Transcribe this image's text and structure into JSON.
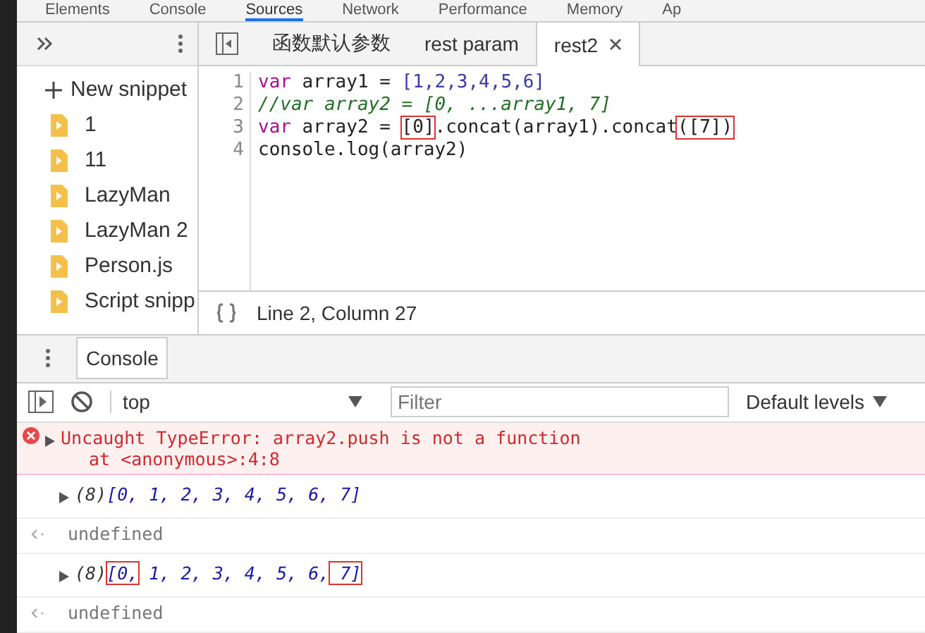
{
  "main_tabs": [
    {
      "label": "Elements",
      "selected": false
    },
    {
      "label": "Console",
      "selected": false
    },
    {
      "label": "Sources",
      "selected": true
    },
    {
      "label": "Network",
      "selected": false
    },
    {
      "label": "Performance",
      "selected": false
    },
    {
      "label": "Memory",
      "selected": false
    },
    {
      "label": "Ap",
      "selected": false
    }
  ],
  "sidebar": {
    "new_snippet": "New snippet",
    "items": [
      "1",
      "11",
      "LazyMan",
      "LazyMan 2",
      "Person.js",
      "Script snipp"
    ]
  },
  "editor_tabs": [
    {
      "label": "函数默认参数",
      "selected": false,
      "closable": false
    },
    {
      "label": "rest param",
      "selected": false,
      "closable": false
    },
    {
      "label": "rest2",
      "selected": true,
      "closable": true
    }
  ],
  "code_lines": [
    {
      "number": "1",
      "tokens": [
        {
          "kind": "keyword",
          "text": "var"
        },
        {
          "kind": "plain",
          "text": " array1 = "
        },
        {
          "kind": "number",
          "text": "[1,2,3,4,5,6]"
        }
      ]
    },
    {
      "number": "2",
      "tokens": [
        {
          "kind": "comment",
          "text": "//var array2 = [0, ...array1, 7]"
        }
      ]
    },
    {
      "number": "3",
      "tokens": [
        {
          "kind": "keyword",
          "text": "var"
        },
        {
          "kind": "plain",
          "text": " array2 = "
        },
        {
          "kind": "plain",
          "text": "[0]",
          "boxed": true
        },
        {
          "kind": "plain",
          "text": ".concat(array1).concat"
        },
        {
          "kind": "plain",
          "text": "([7])",
          "boxed": true
        }
      ]
    },
    {
      "number": "4",
      "tokens": [
        {
          "kind": "plain",
          "text": "console.log(array2)"
        }
      ]
    }
  ],
  "status": "Line 2, Column 27",
  "drawer_tab": "Console",
  "console_toolbar": {
    "context": "top",
    "filter_placeholder": "Filter",
    "levels": "Default levels"
  },
  "messages": [
    {
      "kind": "error",
      "lines": [
        "Uncaught TypeError: array2.push is not a function",
        "at <anonymous>:4:8"
      ]
    },
    {
      "kind": "array",
      "count": "(8)",
      "parts": [
        {
          "text": "[0,",
          "boxed": false
        },
        {
          "text": " 1, 2, 3, 4, 5, 6,",
          "boxed": false
        },
        {
          "text": " 7]",
          "boxed": false
        }
      ]
    },
    {
      "kind": "result",
      "lines": [
        "undefined"
      ]
    },
    {
      "kind": "array",
      "count": "(8)",
      "parts": [
        {
          "text": "[0,",
          "boxed": true
        },
        {
          "text": " 1, 2, 3, 4, 5, 6,",
          "boxed": false
        },
        {
          "text": " 7]",
          "boxed": true
        }
      ]
    },
    {
      "kind": "result",
      "lines": [
        "undefined"
      ]
    }
  ]
}
